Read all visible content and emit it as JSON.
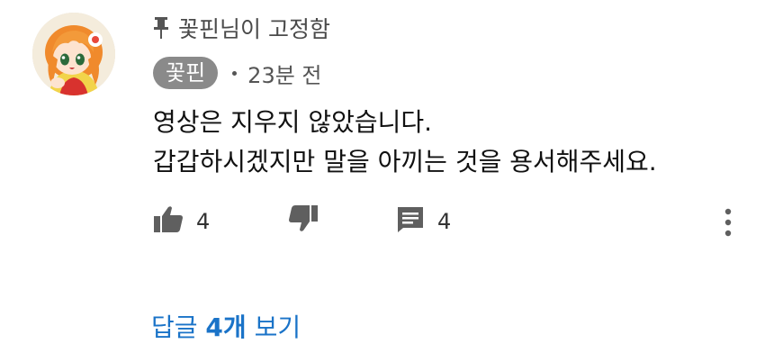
{
  "pinned": {
    "text": "꽃핀님이 고정함",
    "icon": "pin-icon"
  },
  "author": {
    "name": "꽃핀",
    "time": "23분 전",
    "avatar_icon": "anime-character-avatar"
  },
  "comment": {
    "lines": [
      "영상은 지우지 않았습니다.",
      "갑갑하시겠지만 말을 아끼는 것을 용서해주세요."
    ]
  },
  "actions": {
    "like_count": "4",
    "reply_count": "4",
    "like_icon": "thumbs-up-icon",
    "dislike_icon": "thumbs-down-icon",
    "reply_icon": "comment-icon",
    "more_icon": "more-vert-icon"
  },
  "view_replies": {
    "prefix": "답글 ",
    "count": "4개",
    "suffix": " 보기"
  },
  "colors": {
    "link": "#1a73c8",
    "badge": "#8a8a8a",
    "icon": "#5f5f5f"
  }
}
